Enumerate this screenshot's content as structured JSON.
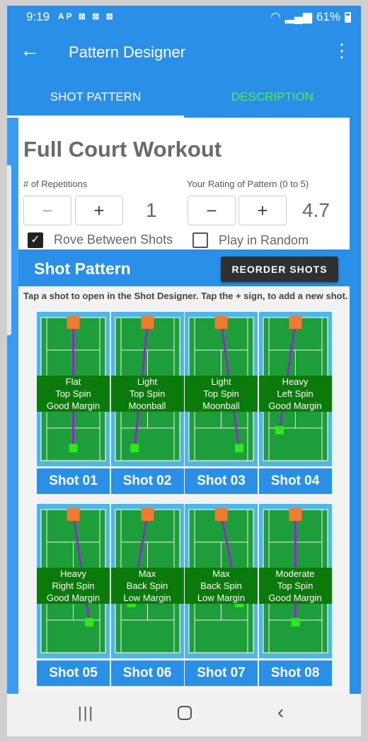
{
  "status": {
    "time": "9:19",
    "left_icons": "AP ⊠ ⊠ ⊠",
    "battery": "61%"
  },
  "app_bar": {
    "title": "Pattern Designer",
    "back_icon": "arrow-back-icon",
    "more_icon": "more-vert-icon"
  },
  "tabs": [
    {
      "label": "SHOT PATTERN",
      "active": true
    },
    {
      "label": "DESCRIPTION",
      "active": false
    }
  ],
  "workout": {
    "title": "Full Court Workout",
    "reps_label": "# of Repetitions",
    "reps_value": "1",
    "rating_label": "Your Rating of Pattern (0 to 5)",
    "rating_value": "4.7",
    "minus": "−",
    "plus": "+",
    "rove_label": "Rove Between Shots",
    "rove_checked": true,
    "random_label": "Play in Random Order",
    "random_checked": false
  },
  "pattern": {
    "title": "Shot Pattern",
    "reorder_label": "REORDER SHOTS",
    "hint": "Tap a shot to open in the Shot Designer. Tap the + sign, to add a new shot."
  },
  "shots": [
    {
      "label": "Shot 01",
      "info": [
        "Flat",
        "Top Spin",
        "Good Margin"
      ],
      "from": 0.5,
      "to": 0.5,
      "to_depth": 0.95
    },
    {
      "label": "Shot 02",
      "info": [
        "Light",
        "Top Spin",
        "Moonball"
      ],
      "from": 0.5,
      "to": 0.3,
      "to_depth": 0.95
    },
    {
      "label": "Shot 03",
      "info": [
        "Light",
        "Top Spin",
        "Moonball"
      ],
      "from": 0.5,
      "to": 0.78,
      "to_depth": 0.95
    },
    {
      "label": "Shot 04",
      "info": [
        "Heavy",
        "Left Spin",
        "Good Margin"
      ],
      "from": 0.5,
      "to": 0.25,
      "to_depth": 0.82
    },
    {
      "label": "Shot 05",
      "info": [
        "Heavy",
        "Right Spin",
        "Good Margin"
      ],
      "from": 0.5,
      "to": 0.75,
      "to_depth": 0.82
    },
    {
      "label": "Shot 06",
      "info": [
        "Max",
        "Back Spin",
        "Low Margin"
      ],
      "from": 0.5,
      "to": 0.25,
      "to_depth": 0.68
    },
    {
      "label": "Shot 07",
      "info": [
        "Max",
        "Back Spin",
        "Low Margin"
      ],
      "from": 0.5,
      "to": 0.78,
      "to_depth": 0.68
    },
    {
      "label": "Shot 08",
      "info": [
        "Moderate",
        "Top Spin",
        "Good Margin"
      ],
      "from": 0.5,
      "to": 0.5,
      "to_depth": 0.82
    }
  ],
  "colors": {
    "primary": "#2a8fe6",
    "accent_tab": "#4cf24c",
    "court": "#1e9e3a",
    "court_out": "#4fb7e8",
    "trajectory": "#8b2ec8",
    "origin": "#f07a30",
    "target": "#2ee81a"
  }
}
